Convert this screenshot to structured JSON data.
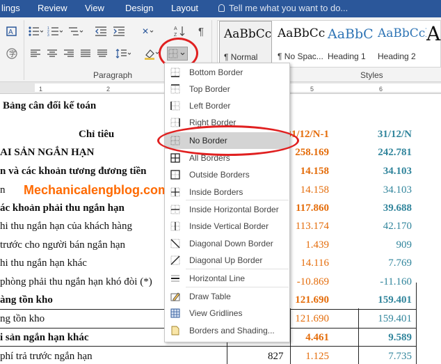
{
  "tabs": [
    "lings",
    "Review",
    "View",
    "Design",
    "Layout"
  ],
  "tell_me": "Tell me what you want to do...",
  "ribbon": {
    "paragraph_label": "Paragraph",
    "styles_label": "Styles",
    "styles": [
      {
        "preview": "AaBbCc",
        "name": "¶ Normal"
      },
      {
        "preview": "AaBbCc",
        "name": "¶ No Spac..."
      },
      {
        "preview": "AaBbC",
        "name": "Heading 1"
      },
      {
        "preview": "AaBbCcl",
        "name": "Heading 2"
      },
      {
        "preview": "A",
        "name": ""
      }
    ]
  },
  "ruler_ticks": [
    "1",
    "2",
    "5",
    "6"
  ],
  "document": {
    "title": "Bảng cân đối kế toán",
    "header": {
      "col0": "Chỉ tiêu",
      "col1": "31/12/N-1",
      "col2": "31/12/N"
    },
    "rows": [
      {
        "label": "AI SẢN NGẮN HẠN",
        "v1": "258.169",
        "v2": "242.781",
        "bold": true
      },
      {
        "label": "n và các khoản tương đương tiền",
        "v1": "14.158",
        "v2": "34.103",
        "bold": true
      },
      {
        "label": "n",
        "v1": "14.158",
        "v2": "34.103",
        "bold": false
      },
      {
        "label": "ác khoản phải thu ngắn hạn",
        "v1": "117.860",
        "v2": "39.688",
        "bold": true
      },
      {
        "label": "hi thu ngắn hạn của khách hàng",
        "v1": "113.174",
        "v2": "42.170",
        "bold": false
      },
      {
        "label": "trước cho người bán ngắn hạn",
        "v1": "1.439",
        "v2": "909",
        "bold": false
      },
      {
        "label": "hi thu ngắn hạn khác",
        "v1": "14.116",
        "v2": "7.769",
        "bold": false
      },
      {
        "label": "phòng phải thu ngắn hạn khó đòi (*)",
        "v1": "-10.869",
        "v2": "-11.160",
        "bold": false
      },
      {
        "label": "àng tồn kho",
        "v1": "121.690",
        "v2": "159.401",
        "bold": true
      },
      {
        "label": "ng tồn kho",
        "v1": "121.690",
        "v2": "159.401",
        "bold": false
      },
      {
        "label": "i sản ngắn hạn khác",
        "v1": "4.461",
        "v2": "9.589",
        "bold": true
      },
      {
        "label": "phí trả trước ngắn hạn",
        "v0": "827",
        "v1": "1.125",
        "v2": "7.735",
        "bold": false
      }
    ],
    "watermark": "Mechanicalengblog.com"
  },
  "border_menu": {
    "items": [
      {
        "label": "Bottom Border",
        "icon": "bottom-border-icon"
      },
      {
        "label": "Top Border",
        "icon": "top-border-icon"
      },
      {
        "label": "Left Border",
        "icon": "left-border-icon"
      },
      {
        "label": "Right Border",
        "icon": "right-border-icon"
      },
      {
        "label": "No Border",
        "icon": "no-border-icon"
      },
      {
        "label": "All Borders",
        "icon": "all-borders-icon"
      },
      {
        "label": "Outside Borders",
        "icon": "outside-borders-icon"
      },
      {
        "label": "Inside Borders",
        "icon": "inside-borders-icon"
      },
      {
        "label": "Inside Horizontal Border",
        "icon": "inside-horizontal-border-icon"
      },
      {
        "label": "Inside Vertical Border",
        "icon": "inside-vertical-border-icon"
      },
      {
        "label": "Diagonal Down Border",
        "icon": "diagonal-down-border-icon"
      },
      {
        "label": "Diagonal Up Border",
        "icon": "diagonal-up-border-icon"
      },
      {
        "label": "Horizontal Line",
        "icon": "horizontal-line-icon"
      },
      {
        "label": "Draw Table",
        "icon": "draw-table-icon"
      },
      {
        "label": "View Gridlines",
        "icon": "view-gridlines-icon"
      },
      {
        "label": "Borders and Shading...",
        "icon": "borders-shading-icon"
      }
    ],
    "highlighted": "No Border"
  },
  "colors": {
    "ribbon_blue": "#2b579a",
    "orange_values": "#e46c0a",
    "teal_values": "#31859c",
    "callout_red": "#e02020",
    "watermark": "#ff6a00"
  }
}
